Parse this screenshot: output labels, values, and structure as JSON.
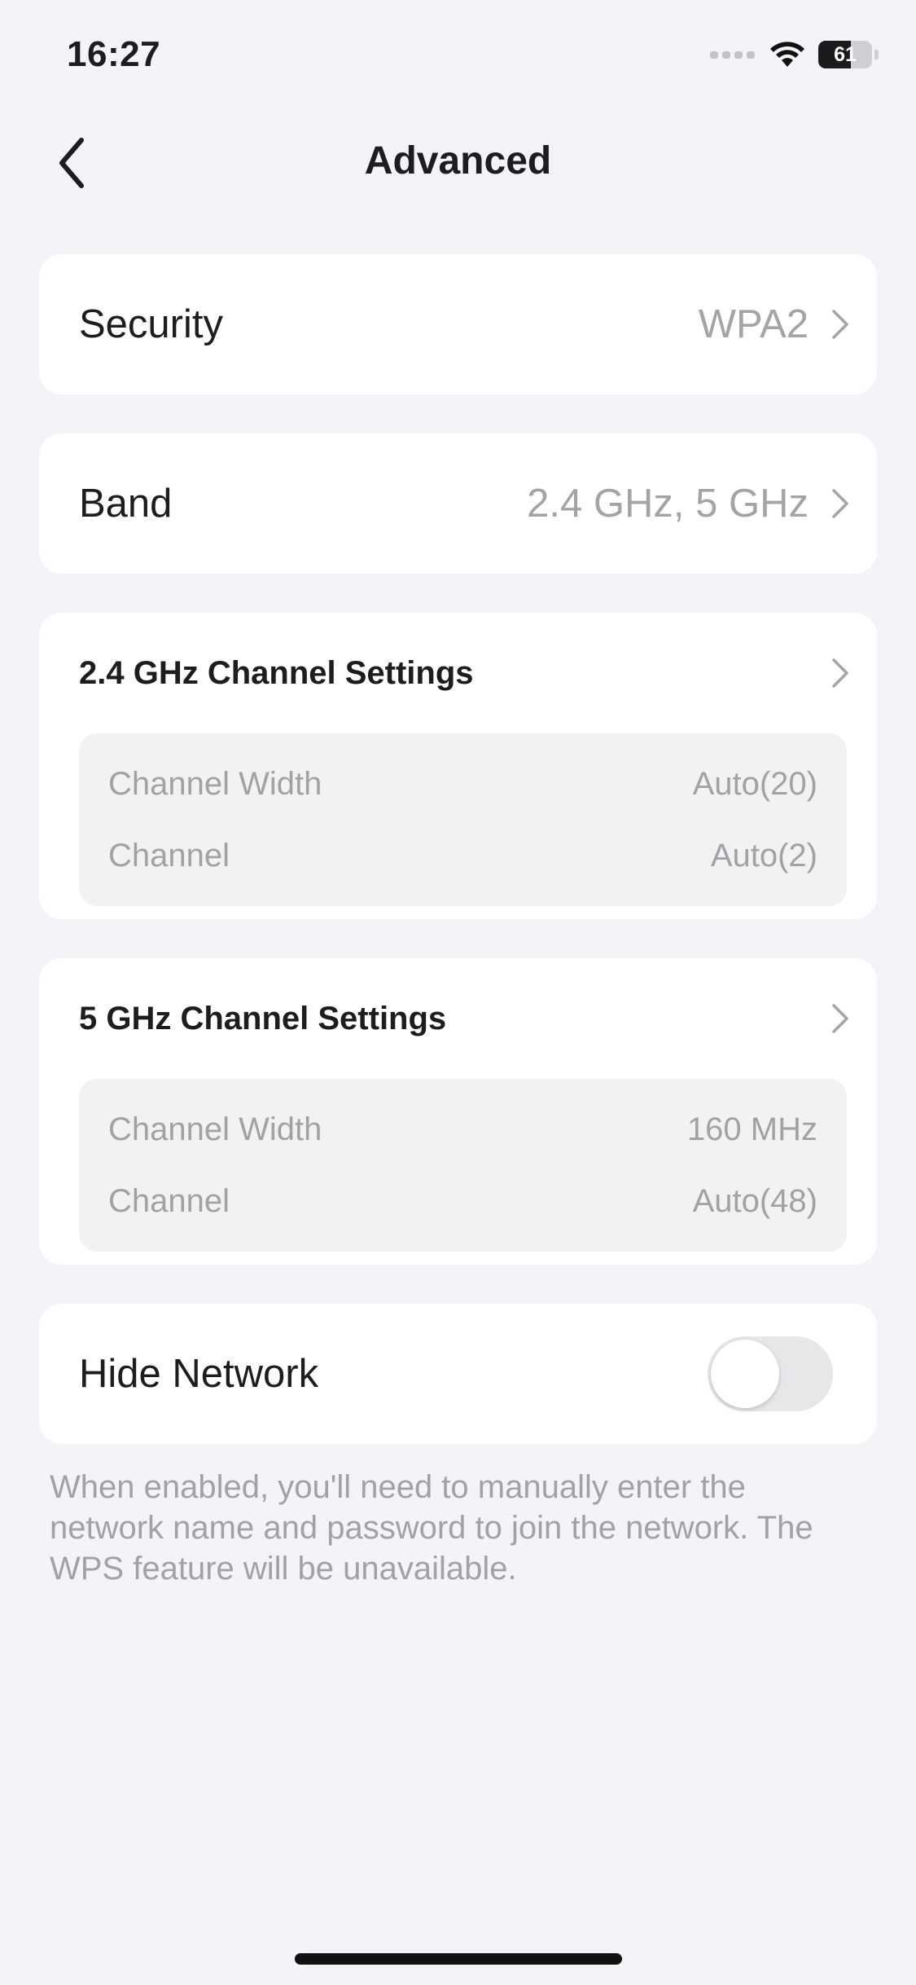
{
  "status_bar": {
    "time": "16:27",
    "battery_level": 61,
    "battery_text": "61",
    "icons": [
      "cellular-signal-icon",
      "wifi-icon",
      "battery-icon"
    ]
  },
  "nav": {
    "title": "Advanced",
    "back_icon": "chevron-left-icon"
  },
  "security": {
    "label": "Security",
    "value": "WPA2"
  },
  "band": {
    "label": "Band",
    "value": "2.4 GHz, 5 GHz"
  },
  "channel_24": {
    "title": "2.4 GHz Channel Settings",
    "rows": [
      {
        "label": "Channel Width",
        "value": "Auto(20)"
      },
      {
        "label": "Channel",
        "value": "Auto(2)"
      }
    ]
  },
  "channel_5": {
    "title": "5 GHz Channel Settings",
    "rows": [
      {
        "label": "Channel Width",
        "value": "160 MHz"
      },
      {
        "label": "Channel",
        "value": "Auto(48)"
      }
    ]
  },
  "hide_network": {
    "label": "Hide Network",
    "enabled": false,
    "hint": "When enabled, you'll need to manually enter the network name and password to join the network. The WPS feature will be unavailable."
  },
  "colors": {
    "background": "#f3f4f8",
    "card": "#ffffff",
    "secondary_text": "#a4a4a8",
    "detail_box": "#f2f2f3",
    "toggle_off": "#e7e7ea"
  }
}
